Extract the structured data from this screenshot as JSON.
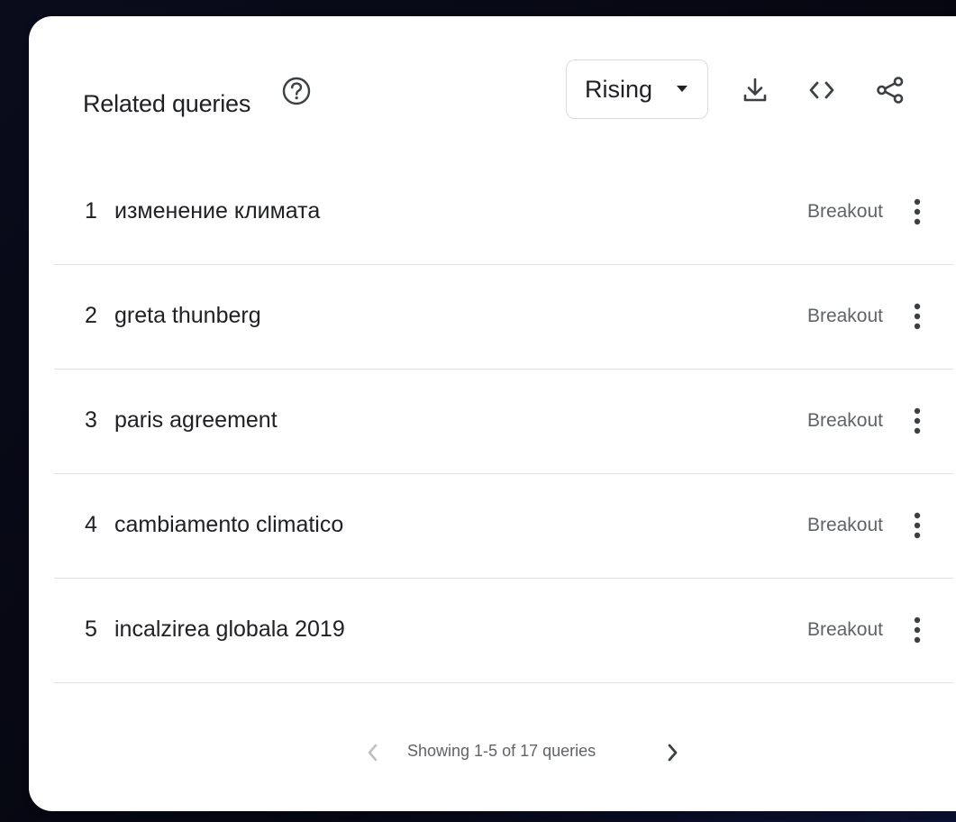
{
  "panel": {
    "title": "Related queries",
    "help_icon": "help-circle-icon",
    "sort_dropdown": {
      "selected": "Rising"
    },
    "toolbar_icons": [
      "download-icon",
      "embed-code-icon",
      "share-icon"
    ]
  },
  "queries": [
    {
      "rank": "1",
      "query": "изменение климата",
      "value": "Breakout"
    },
    {
      "rank": "2",
      "query": "greta thunberg",
      "value": "Breakout"
    },
    {
      "rank": "3",
      "query": "paris agreement",
      "value": "Breakout"
    },
    {
      "rank": "4",
      "query": "cambiamento climatico",
      "value": "Breakout"
    },
    {
      "rank": "5",
      "query": "incalzirea globala 2019",
      "value": "Breakout"
    }
  ],
  "pagination": {
    "text": "Showing 1-5 of 17 queries",
    "prev_enabled": false,
    "next_enabled": true
  },
  "colors": {
    "text_primary": "#202124",
    "text_secondary": "#5f6368",
    "divider": "#e0e0e0",
    "disabled": "#bdc1c6"
  }
}
